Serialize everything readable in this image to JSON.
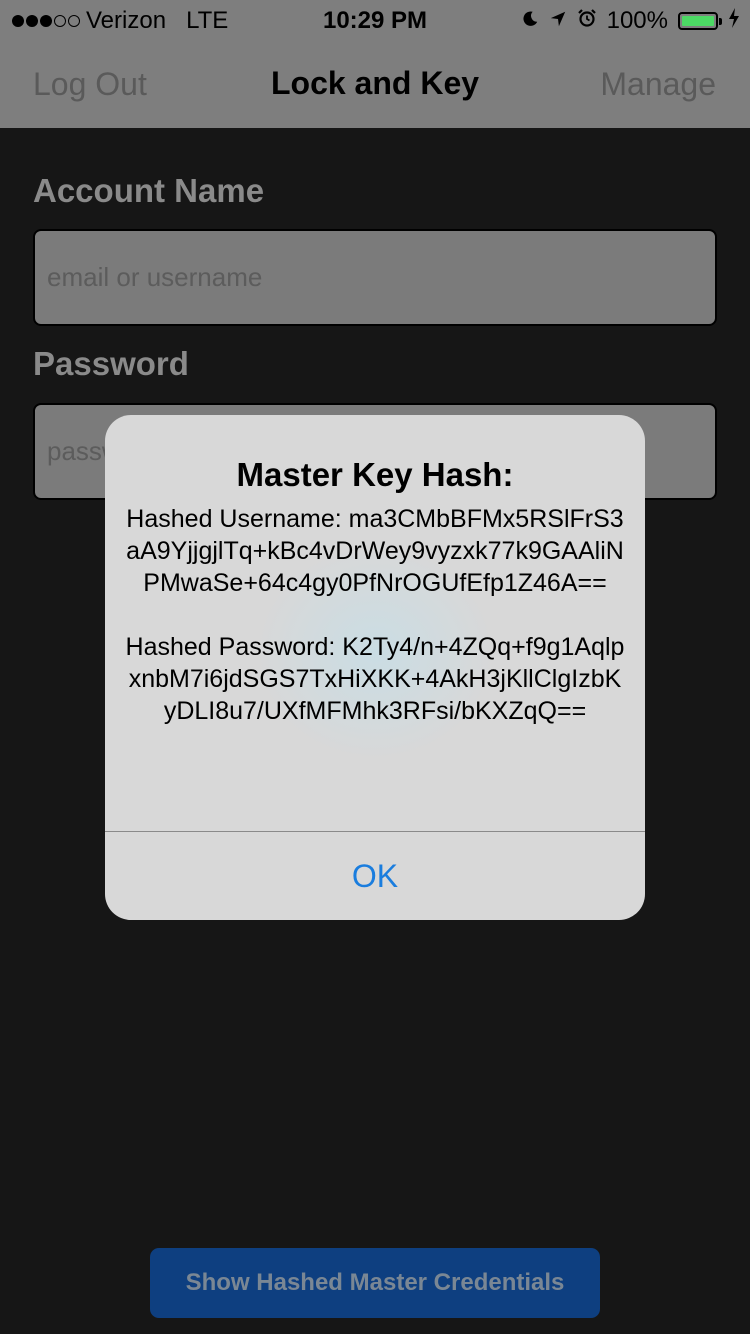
{
  "status_bar": {
    "carrier": "Verizon",
    "network": "LTE",
    "time": "10:29 PM",
    "battery": "100%",
    "battery_level": 1.0,
    "signal_bars": 3,
    "signal_total": 5,
    "icons": [
      "moon-icon",
      "location-arrow-icon",
      "alarm-clock-icon",
      "battery-icon",
      "charging-bolt-icon"
    ]
  },
  "nav": {
    "left_label": "Log Out",
    "title": "Lock and Key",
    "right_label": "Manage"
  },
  "form": {
    "account_label": "Account Name",
    "account_placeholder": "email or username",
    "password_label": "Password",
    "password_placeholder": "password"
  },
  "bottom_button": {
    "label": "Show Hashed Master Credentials"
  },
  "alert": {
    "title": "Master Key Hash:",
    "message": "Hashed Username: ma3CMbBFMx5RSlFrS3aA9YjjgjlTq+kBc4vDrWey9vyzxk77k9GAAliNPMwaSe+64c4gy0PfNrOGUfEfp1Z46A==\n\nHashed Password: K2Ty4/n+4ZQq+f9g1AqlpxnbM7i6jdSGS7TxHiXKK+4AkH3jKllClgIzbKyDLI8u7/UXfMFMhk3RFsi/bKXZqQ==",
    "ok_label": "OK"
  },
  "colors": {
    "background": "#161616",
    "bar": "#7e7e7e",
    "accent": "#1a7dde",
    "button": "#0e3f80",
    "battery": "#4cd964"
  }
}
